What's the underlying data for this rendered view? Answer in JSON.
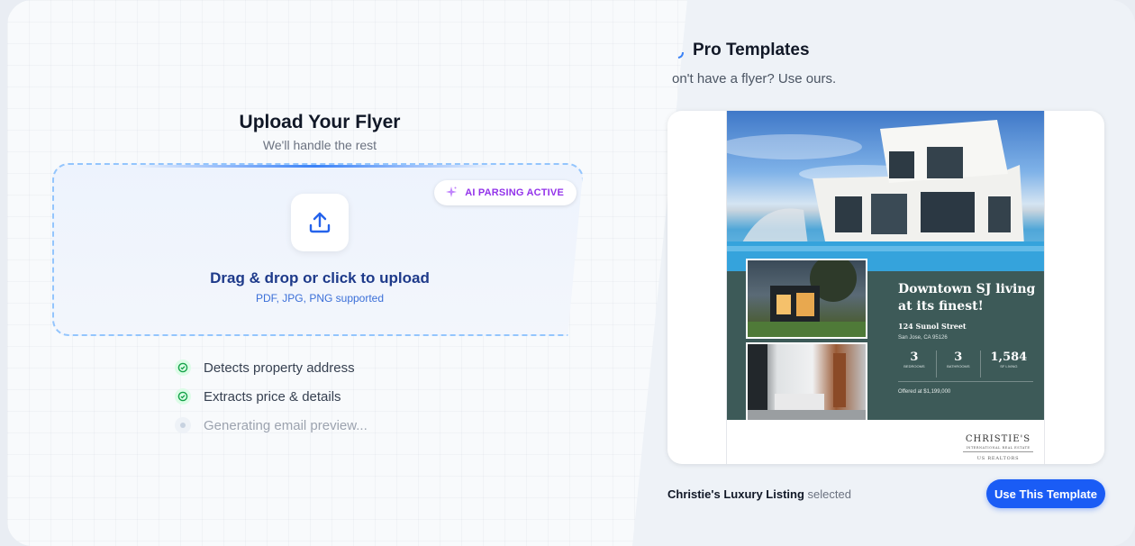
{
  "upload": {
    "title": "Upload Your Flyer",
    "subtitle": "We'll handle the rest",
    "badge": "AI PARSING ACTIVE",
    "drop_main": "Drag & drop or click to upload",
    "drop_sub": "PDF, JPG, PNG supported",
    "features": [
      {
        "label": "Detects property address",
        "status": "done"
      },
      {
        "label": "Extracts price & details",
        "status": "done"
      },
      {
        "label": "Generating email preview...",
        "status": "pending"
      }
    ]
  },
  "templates": {
    "title": "Pro Templates",
    "subtitle": "on't have a flyer? Use ours.",
    "flyer": {
      "headline": "Downtown SJ living at its finest!",
      "street": "124 Sunol Street",
      "city": "San Jose, CA 95126",
      "stats": [
        {
          "value": "3",
          "label": "BEDROOMS"
        },
        {
          "value": "3",
          "label": "BATHROOMS"
        },
        {
          "value": "1,584",
          "label": "SF LIVING"
        }
      ],
      "offer": "Offered at $1,199,000",
      "brand": "CHRISTIE'S",
      "brand_sub": "INTERNATIONAL REAL ESTATE",
      "brand_sub2": "US REALTORS"
    },
    "selected_name": "Christie's Luxury Listing",
    "selected_suffix": "selected",
    "button": "Use This Template"
  },
  "colors": {
    "accent": "#1a5cf5",
    "badge": "#9333ea",
    "flyer_green": "#3d5a58"
  }
}
